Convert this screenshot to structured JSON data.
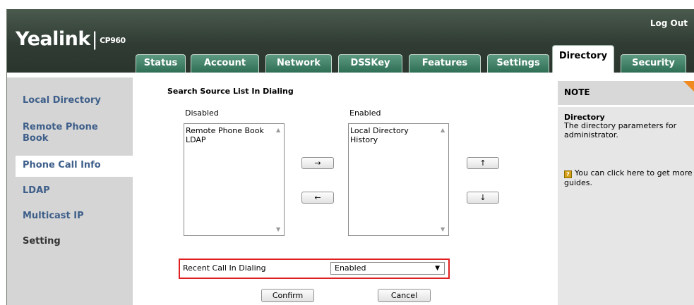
{
  "header": {
    "logout": "Log Out",
    "brand": "Yealink",
    "model": "CP960"
  },
  "tabs": [
    {
      "label": "Status"
    },
    {
      "label": "Account"
    },
    {
      "label": "Network"
    },
    {
      "label": "DSSKey"
    },
    {
      "label": "Features"
    },
    {
      "label": "Settings"
    },
    {
      "label": "Directory",
      "active": true
    },
    {
      "label": "Security"
    }
  ],
  "sidebar": {
    "items": [
      {
        "label": "Local Directory"
      },
      {
        "label": "Remote Phone Book"
      },
      {
        "label": "Phone Call Info"
      },
      {
        "label": "LDAP"
      },
      {
        "label": "Multicast IP"
      },
      {
        "label": "Setting",
        "active": true
      }
    ]
  },
  "main": {
    "section_title": "Search Source List In Dialing",
    "disabled_label": "Disabled",
    "enabled_label": "Enabled",
    "disabled_items": [
      "Remote Phone Book",
      "LDAP"
    ],
    "enabled_items": [
      "Local Directory",
      "History"
    ],
    "move_right": "→",
    "move_left": "←",
    "move_up": "↑",
    "move_down": "↓",
    "recent_call_label": "Recent Call In Dialing",
    "recent_call_value": "Enabled",
    "confirm": "Confirm",
    "cancel": "Cancel"
  },
  "note": {
    "title": "NOTE",
    "heading": "Directory",
    "text": "The directory parameters for administrator.",
    "guide": "You can click here to get more guides."
  },
  "colors": {
    "header_dark": "#2f3b33",
    "tab_green": "#2d6e55",
    "nav_link": "#3e5f8a",
    "highlight_red": "#e02020",
    "note_accent": "#f08a20"
  }
}
